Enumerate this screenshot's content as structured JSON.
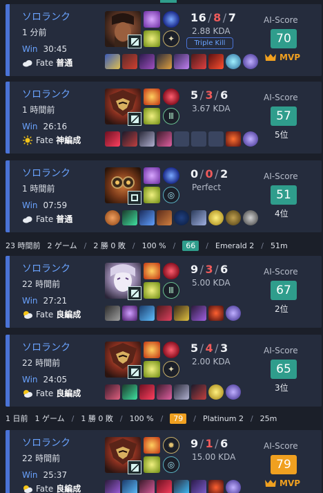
{
  "matches": [
    {
      "mode": "ソロランク",
      "ago": "1 分前",
      "win_label": "Win",
      "duration": "30:45",
      "fate_label": "Fate",
      "fate_value": "普通",
      "weather": "cloud",
      "kills": "16",
      "deaths": "8",
      "assists": "7",
      "kda_ratio": "2.88 KDA",
      "multikill": "Triple Kill",
      "ai_label": "AI-Score",
      "ai_score": "70",
      "ai_color": "#2f9d8c",
      "placement": "MVP",
      "champion": "brown-bearded-champion",
      "item_count": 9
    },
    {
      "mode": "ソロランク",
      "ago": "1 時間前",
      "win_label": "Win",
      "duration": "26:16",
      "fate_label": "Fate",
      "fate_value": "神編成",
      "weather": "sun",
      "kills": "5",
      "deaths": "3",
      "assists": "6",
      "kda_ratio": "3.67 KDA",
      "ai_label": "AI-Score",
      "ai_score": "57",
      "ai_color": "#2f9d8c",
      "placement": "5位",
      "champion": "red-armored-champion"
    },
    {
      "mode": "ソロランク",
      "ago": "1 時間前",
      "win_label": "Win",
      "duration": "07:59",
      "fate_label": "Fate",
      "fate_value": "普通",
      "weather": "cloud",
      "kills": "0",
      "deaths": "0",
      "assists": "2",
      "kda_ratio": "Perfect",
      "ai_label": "AI-Score",
      "ai_score": "51",
      "ai_color": "#2f9d8c",
      "placement": "4位",
      "champion": "goggles-champion"
    },
    {
      "mode": "ソロランク",
      "ago": "22 時間前",
      "win_label": "Win",
      "duration": "27:21",
      "fate_label": "Fate",
      "fate_value": "良編成",
      "weather": "partly-cloudy",
      "kills": "9",
      "deaths": "3",
      "assists": "6",
      "kda_ratio": "5.00 KDA",
      "ai_label": "AI-Score",
      "ai_score": "67",
      "ai_color": "#2f9d8c",
      "placement": "2位",
      "champion": "pale-champion"
    },
    {
      "mode": "ソロランク",
      "ago": "22 時間前",
      "win_label": "Win",
      "duration": "24:05",
      "fate_label": "Fate",
      "fate_value": "良編成",
      "weather": "partly-cloudy",
      "kills": "5",
      "deaths": "4",
      "assists": "3",
      "kda_ratio": "2.00 KDA",
      "ai_label": "AI-Score",
      "ai_score": "65",
      "ai_color": "#2f9d8c",
      "placement": "3位",
      "champion": "red-armored-champion"
    },
    {
      "mode": "ソロランク",
      "ago": "22 時間前",
      "win_label": "Win",
      "duration": "25:37",
      "fate_label": "Fate",
      "fate_value": "良編成",
      "weather": "partly-cloudy",
      "kills": "9",
      "deaths": "1",
      "assists": "6",
      "kda_ratio": "15.00 KDA",
      "ai_label": "AI-Score",
      "ai_score": "79",
      "ai_color": "#f0a020",
      "placement": "MVP",
      "champion": "red-armored-champion"
    }
  ],
  "separators": [
    {
      "ago": "23 時間前",
      "games": "2 ゲーム",
      "record": "2 勝 0 敗",
      "winrate": "100 %",
      "score": "66",
      "score_color": "#2f9d8c",
      "rank": "Emerald 2",
      "duration": "51m"
    },
    {
      "ago": "1 日前",
      "games": "1 ゲーム",
      "record": "1 勝 0 敗",
      "winrate": "100 %",
      "score": "79",
      "score_color": "#f0a020",
      "rank": "Platinum 2",
      "duration": "25m"
    }
  ]
}
